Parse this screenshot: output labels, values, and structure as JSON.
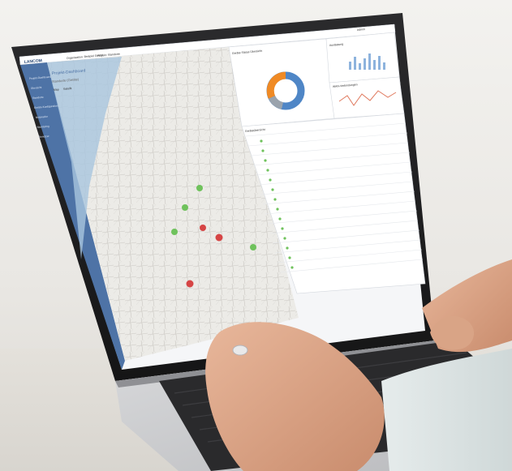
{
  "photo": {
    "brand_text": "LANCOM",
    "screen": {
      "breadcrumb_first": "Organisation: Beispiel GmbH",
      "breadcrumb_second": "Projekt: Standorte",
      "page_title": "Projekt-Dashboard",
      "subtitle": "Standorte (Geräte)",
      "map_tab_1": "Map",
      "map_tab_2": "Satellit",
      "panel_status": "Geräte Status Übersicht",
      "panel_traffic": "Auslastung",
      "panel_wan": "WAN-Verbindungen",
      "table_title": "Geräteübersicht",
      "sidebar_items": [
        "Projekt-Dashboard",
        "Übersicht",
        "Standorte",
        "Geräte-Konfiguration",
        "Netzwerke",
        "Monitoring",
        "Benutzer"
      ],
      "user_label": "Admin",
      "colors": {
        "sidebar": "#4e73a6",
        "accent": "#5a86c1",
        "pin_green": "#6fc25c",
        "pin_red": "#d64545",
        "donut_orange": "#f08a24",
        "donut_blue": "#4f86c6",
        "donut_grey": "#9aa3ad"
      }
    }
  }
}
